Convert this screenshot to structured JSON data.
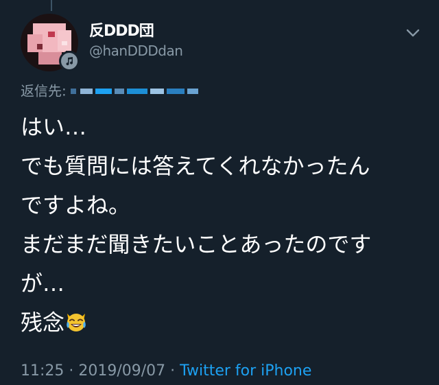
{
  "tweet": {
    "author": {
      "display_name": "反DDD団",
      "handle": "@hanDDDdan",
      "avatar_icon": "pixelated-avatar",
      "badge_icon": "music-note-icon"
    },
    "reply_to": {
      "label": "返信先:",
      "target": "@…(obscured)"
    },
    "body_lines": [
      "はい…",
      "でも質問には答えてくれなかったん",
      "ですよね。",
      "まだまだ聞きたいことあったのです",
      "が…",
      "残念"
    ],
    "emoji": "crying-laughing-cat-emoji",
    "timestamp": "11:25 · 2019/09/07",
    "separator": " · ",
    "source": "Twitter for iPhone",
    "menu_icon": "chevron-down-icon"
  },
  "colors": {
    "background": "#15202b",
    "primary_text": "#ffffff",
    "secondary_text": "#8899a6",
    "link": "#1da1f2"
  }
}
